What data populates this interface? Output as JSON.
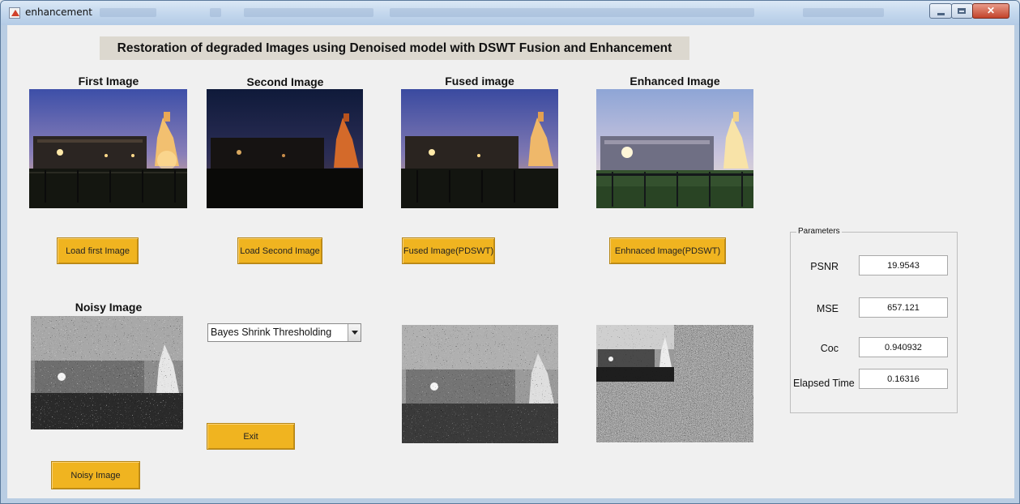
{
  "window": {
    "title": "enhancement"
  },
  "banner": {
    "text": "Restoration of degraded Images using Denoised model with DSWT Fusion and Enhancement"
  },
  "headings": {
    "first": "First Image",
    "second": "Second Image",
    "fused": "Fused image",
    "enhanced": "Enhanced Image",
    "noisy": "Noisy Image"
  },
  "buttons": {
    "load_first": "Load first Image",
    "load_second": "Load Second Image",
    "fused": "Fused Image(PDSWT)",
    "enhanced": "Enhnaced Image(PDSWT)",
    "exit": "Exit",
    "noisy": "Noisy Image"
  },
  "dropdown": {
    "selected": "Bayes Shrink Thresholding"
  },
  "parameters": {
    "title": "Parameters",
    "rows": [
      {
        "label": "PSNR",
        "value": "19.9543"
      },
      {
        "label": "MSE",
        "value": "657.121"
      },
      {
        "label": "Coc",
        "value": "0.940932"
      },
      {
        "label": "Elapsed Time",
        "value": "0.16316"
      }
    ]
  },
  "colors": {
    "button": "#f0b420",
    "background": "#f0f0f0",
    "banner": "#dcd8cf"
  },
  "icons": [
    "matlab-figure-icon",
    "minimize-icon",
    "maximize-icon",
    "close-icon",
    "dropdown-arrow-icon"
  ]
}
